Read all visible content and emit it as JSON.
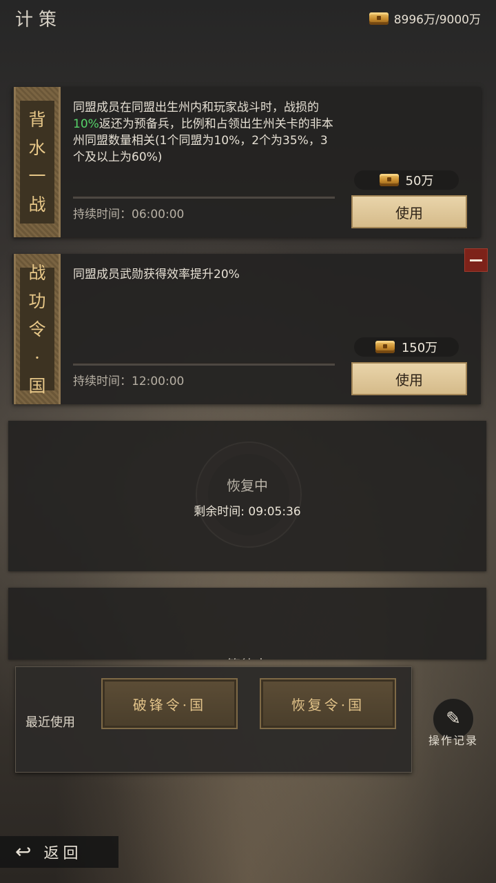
{
  "header": {
    "title": "计策",
    "gold": "8996万/9000万",
    "gold_icon": "gold-chest-icon"
  },
  "cards": [
    {
      "side_chars": [
        "背",
        "水",
        "一",
        "战"
      ],
      "desc_pre": "同盟成员在同盟出生州内和玩家战斗时，战损的",
      "desc_highlight": "10%",
      "desc_post": "返还为预备兵，比例和占领出生州关卡的非本州同盟数量相关(1个同盟为10%，2个为35%，3个及以上为60%)",
      "price": "50万",
      "duration": "持续时间：06:00:00",
      "use_label": "使用"
    },
    {
      "side_chars": [
        "战",
        "功",
        "令",
        "·",
        "国"
      ],
      "desc": "同盟成员武勋获得效率提升20%",
      "price": "150万",
      "duration": "持续时间：12:00:00",
      "use_label": "使用"
    }
  ],
  "recovering": {
    "title": "恢复中",
    "time": "剩余时间: 09:05:36"
  },
  "waiting": {
    "title": "等待中"
  },
  "recent": {
    "label": "最近使用",
    "items": [
      "破锋令·国",
      "恢复令·国"
    ]
  },
  "oplog": {
    "label": "操作记录",
    "icon": "brush-icon"
  },
  "back": {
    "label": "返回"
  },
  "colors": {
    "highlight": "#57d46a",
    "accent_gold": "#e3c48a",
    "use_button": "#e2caa0"
  }
}
